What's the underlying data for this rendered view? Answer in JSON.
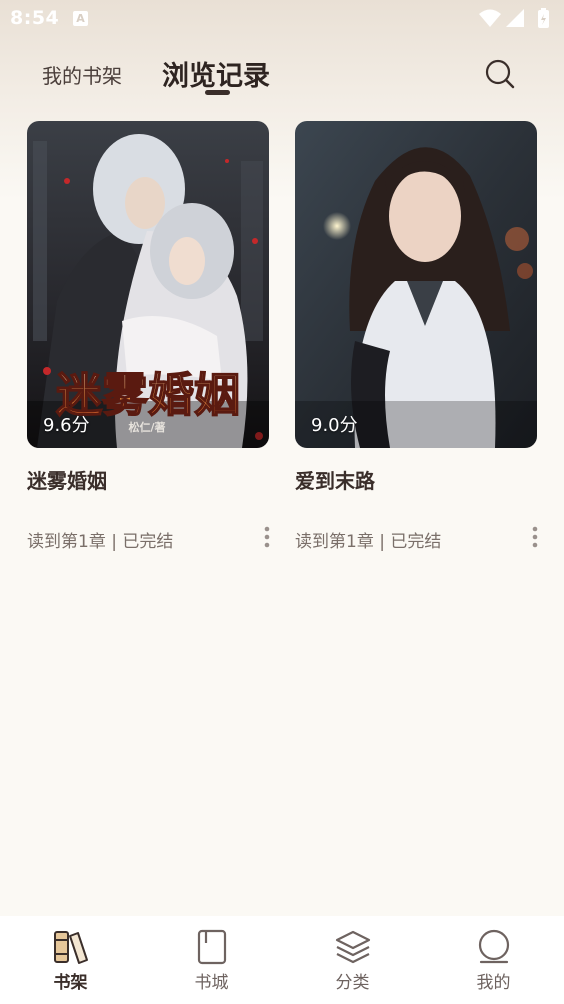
{
  "status_bar": {
    "time": "8:54",
    "notification_icon": "A"
  },
  "header": {
    "tabs": [
      {
        "label": "我的书架",
        "active": false
      },
      {
        "label": "浏览记录",
        "active": true
      }
    ],
    "search_icon": "search-icon"
  },
  "books": [
    {
      "title": "迷雾婚姻",
      "score": "9.6分",
      "progress": "读到第1章 | 已完结",
      "cover_title": "迷雾婚姻",
      "cover_author": "松仁/著"
    },
    {
      "title": "爱到末路",
      "score": "9.0分",
      "progress": "读到第1章 | 已完结"
    }
  ],
  "bottom_nav": {
    "items": [
      {
        "label": "书架",
        "icon": "bookshelf-icon",
        "active": true
      },
      {
        "label": "书城",
        "icon": "book-icon",
        "active": false
      },
      {
        "label": "分类",
        "icon": "layers-icon",
        "active": false
      },
      {
        "label": "我的",
        "icon": "profile-icon",
        "active": false
      }
    ]
  },
  "colors": {
    "accent": "#3a2e2a",
    "background": "#fbf9f4",
    "muted": "#7a6f69"
  }
}
